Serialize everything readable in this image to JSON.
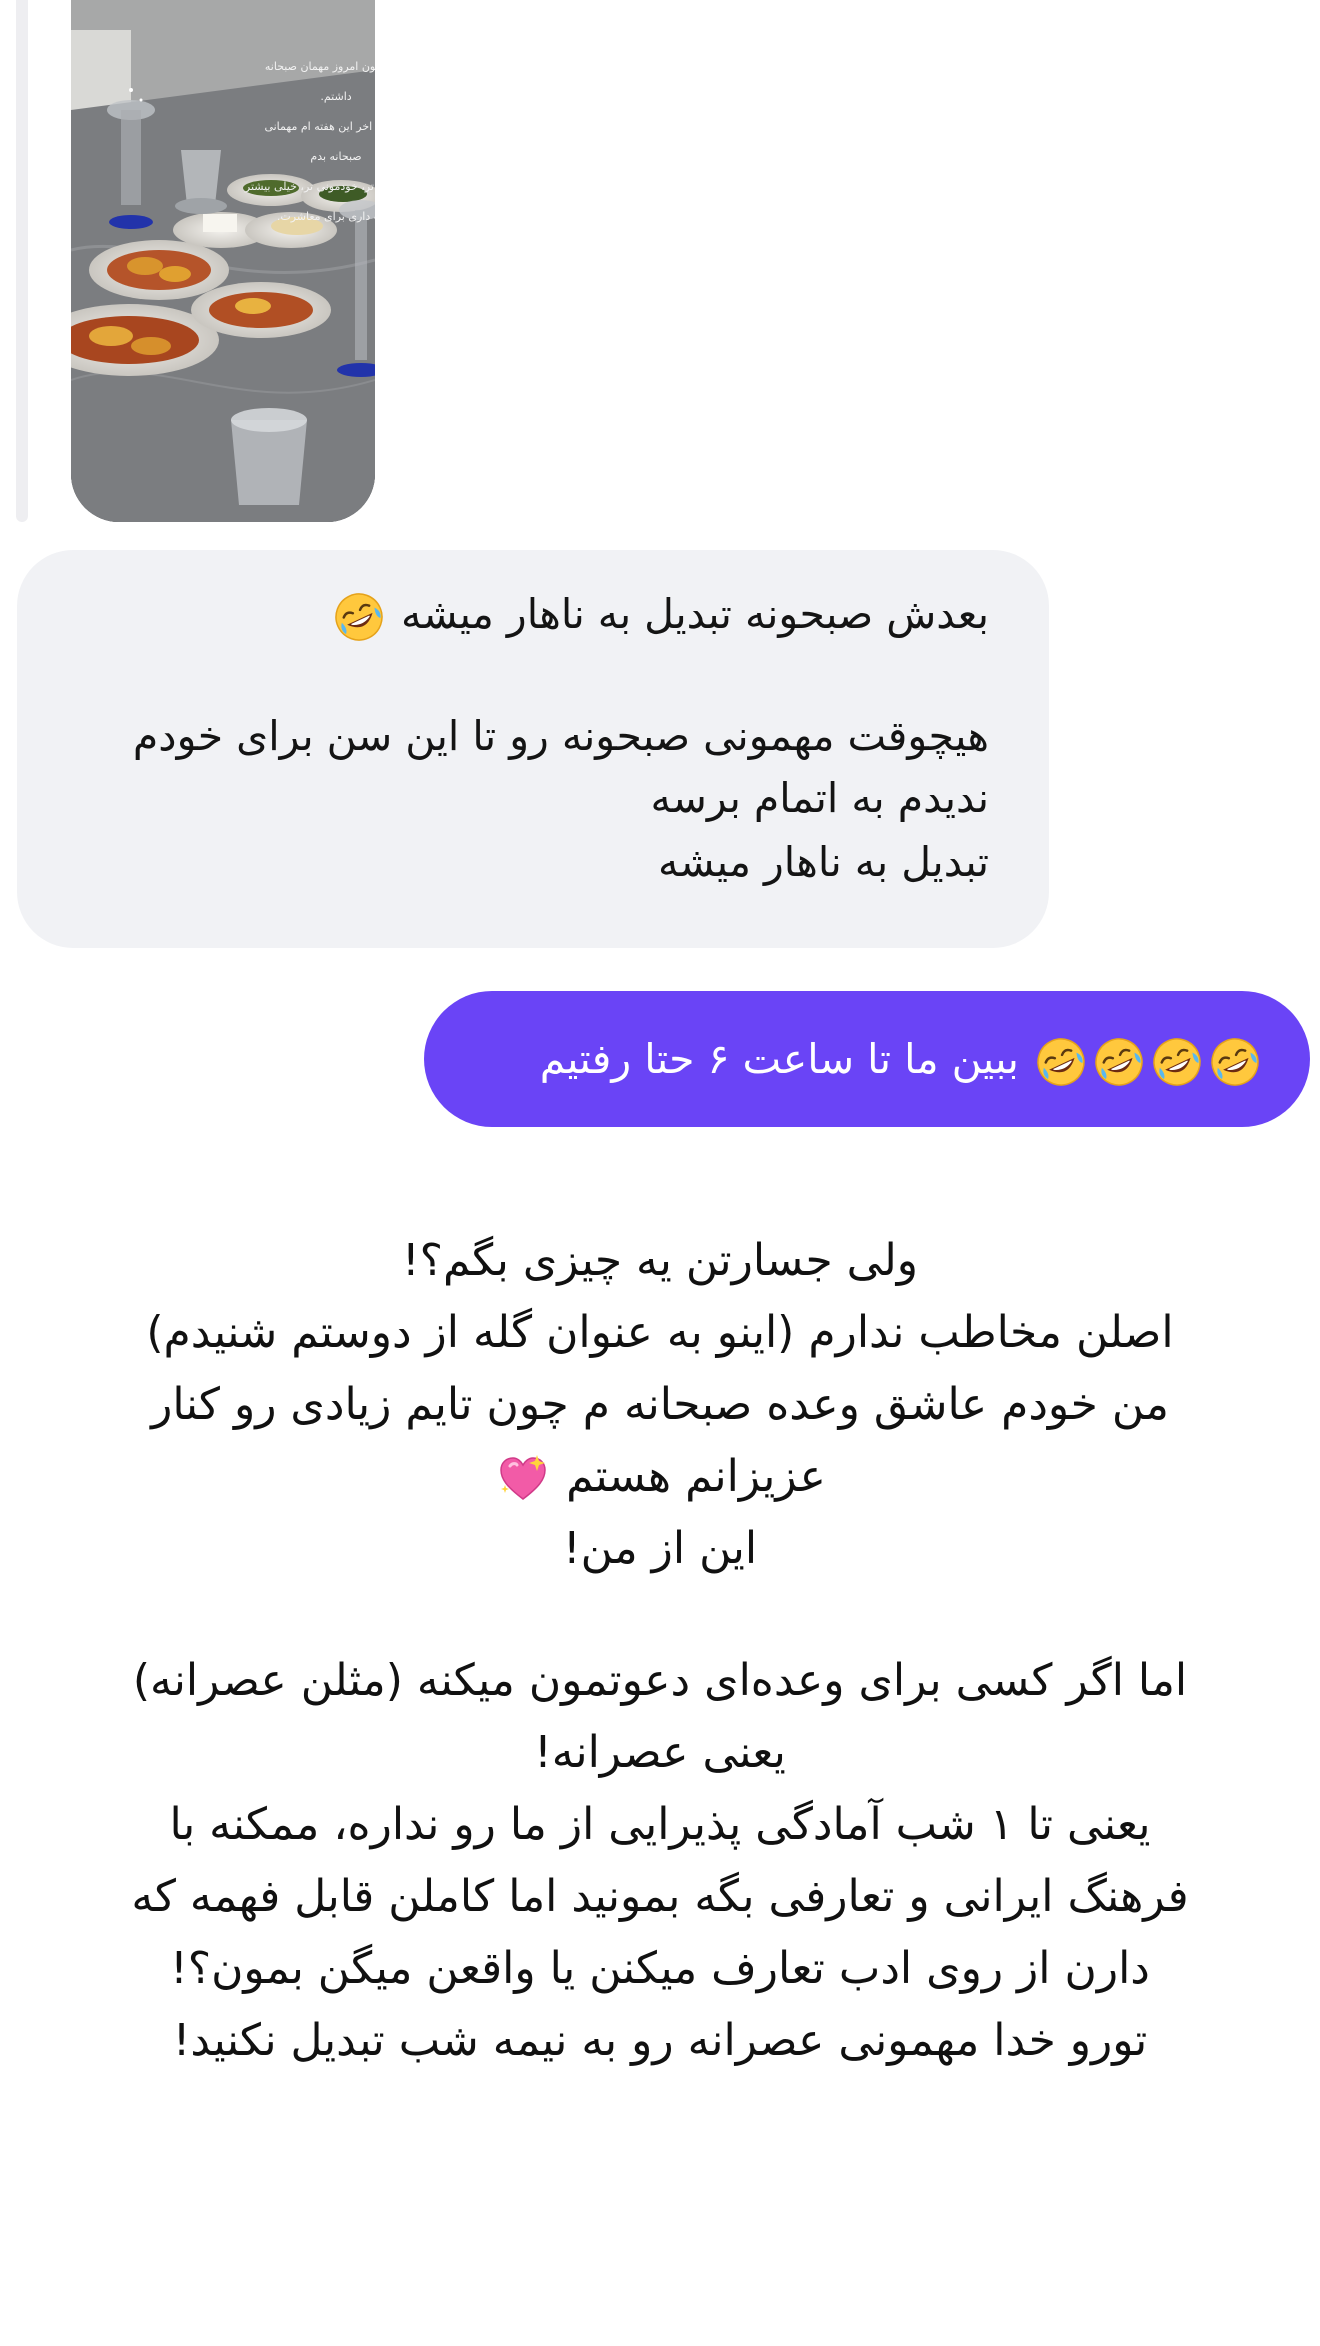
{
  "story_reply": {
    "caption_lines": [
      "با اجازتون امروز مهمان صبحانه",
      "داشتم.",
      "میخوام اخر این هفته ام مهمانی",
      "صبحانه بدم",
      "خیلی ساده تر، خودمونی تر، خیلی بیشتر",
      "وقت داری برای معاشرت."
    ],
    "icons": {
      "thumbnail": "breakfast-table-photo"
    }
  },
  "incoming_message": {
    "lines": [
      "بعدش صبحونه تبدیل به ناهار میشه",
      "هیچوقت مهمونی صبحونه رو تا این سن برای خودم",
      "ندیدم به اتمام برسه",
      "تبدیل به ناهار میشه"
    ],
    "emoji": "rofl-emoji"
  },
  "outgoing_message": {
    "text": "ببین ما تا ساعت ۶ حتا رفتیم",
    "emoji": "rofl-emoji",
    "emoji_count": 4,
    "colors": {
      "bubble": "#6a44f6",
      "text": "#ffffff"
    }
  },
  "note": {
    "lines": [
      "ولی جسارتن یه چیزی بگم؟!",
      "اصلن مخاطب ندارم (اینو به عنوان گله از دوستم شنیدم)",
      "من خودم عاشق وعده صبحانه م چون تایم زیادی رو کنار",
      "عزیزانم هستم",
      "این از من!",
      "اما اگر کسی برای وعده‌ای دعوتمون میکنه (مثلن عصرانه)",
      "یعنی عصرانه!",
      "یعنی تا ۱ شب آمادگی پذیرایی از ما رو نداره، ممکنه با",
      "فرهنگ ایرانی و تعارفی بگه بمونید اما کاملن قابل فهمه که",
      "دارن از روی ادب تعارف میکنن یا واقعن میگن بمون؟!",
      "تورو خدا مهمونی عصرانه رو به نیمه شب تبدیل نکنید!"
    ],
    "emoji": "sparkling-heart-emoji"
  }
}
